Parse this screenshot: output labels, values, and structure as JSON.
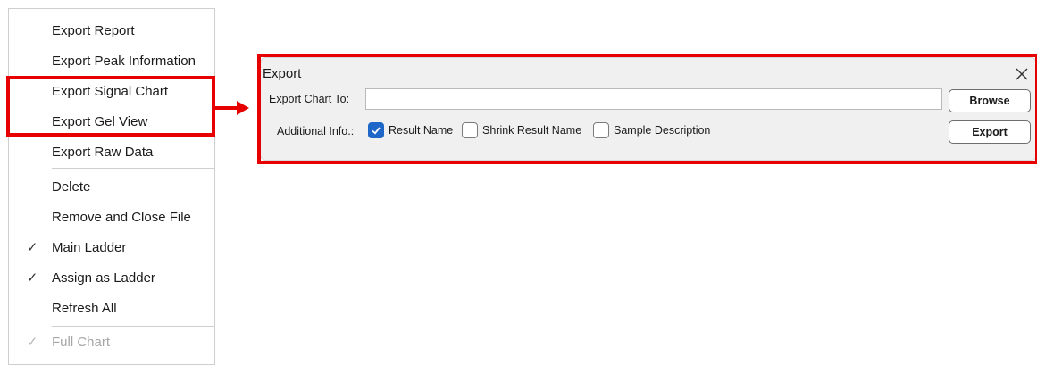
{
  "context_menu": {
    "items": [
      {
        "label": "Export Report",
        "checked": false,
        "disabled": false
      },
      {
        "label": "Export Peak Information",
        "checked": false,
        "disabled": false
      },
      {
        "label": "Export Signal Chart",
        "checked": false,
        "disabled": false
      },
      {
        "label": "Export Gel View",
        "checked": false,
        "disabled": false
      },
      {
        "label": "Export Raw Data",
        "checked": false,
        "disabled": false
      },
      {
        "label": "Delete",
        "checked": false,
        "disabled": false
      },
      {
        "label": "Remove and Close File",
        "checked": false,
        "disabled": false
      },
      {
        "label": "Main Ladder",
        "checked": true,
        "disabled": false
      },
      {
        "label": "Assign as Ladder",
        "checked": true,
        "disabled": false
      },
      {
        "label": "Refresh All",
        "checked": false,
        "disabled": false
      },
      {
        "label": "Full Chart",
        "checked": true,
        "disabled": true
      }
    ],
    "check_glyph": "✓"
  },
  "dialog": {
    "title": "Export",
    "close_icon": "close-icon",
    "export_to_label": "Export Chart To:",
    "path_value": "",
    "browse_label": "Browse",
    "additional_label": "Additional Info.:",
    "options": [
      {
        "label": "Result Name",
        "checked": true
      },
      {
        "label": "Shrink Result Name",
        "checked": false
      },
      {
        "label": "Sample Description",
        "checked": false
      }
    ],
    "export_label": "Export"
  },
  "colors": {
    "highlight": "#e60000",
    "checkbox_checked": "#1e66c8",
    "dialog_bg": "#f0f0f0"
  }
}
